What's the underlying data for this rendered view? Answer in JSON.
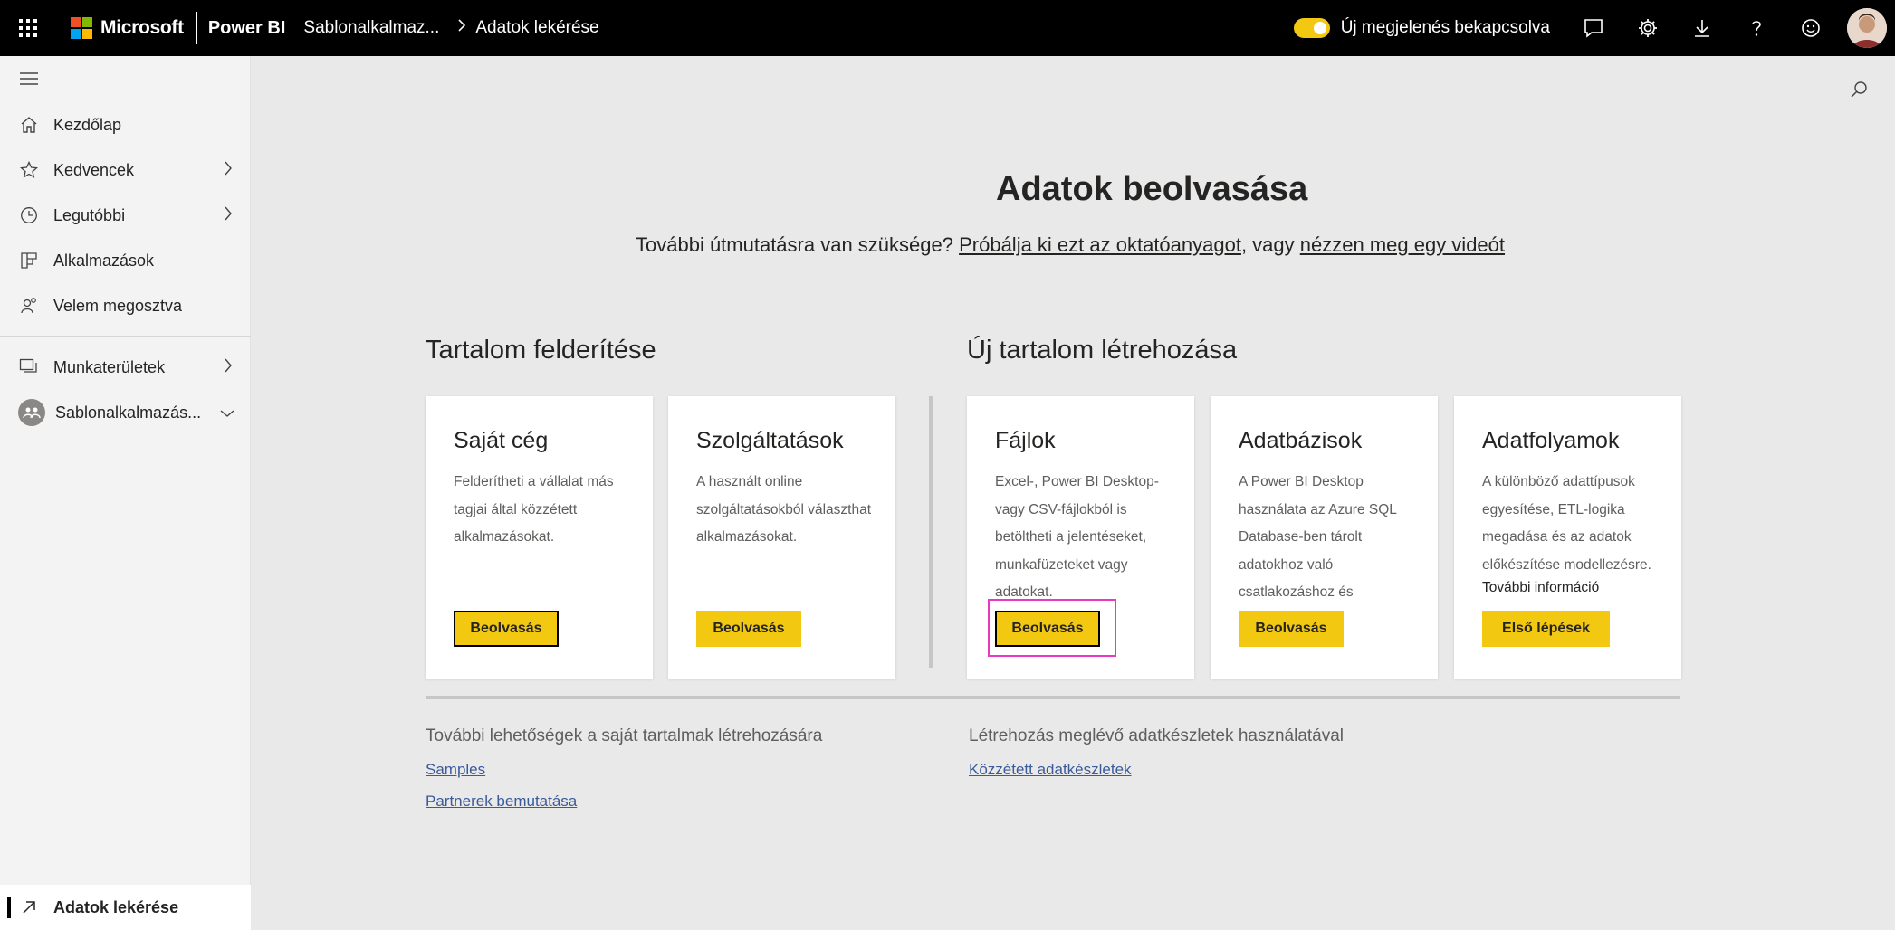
{
  "topbar": {
    "brand": "Microsoft",
    "product": "Power BI",
    "breadcrumb": [
      "Sablonalkalmaz...",
      "Adatok lekérése"
    ],
    "toggle_label": "Új megjelenés bekapcsolva",
    "icons": [
      "chat-icon",
      "gear-icon",
      "download-icon",
      "help-icon",
      "smiley-icon"
    ],
    "accent": "#f2c811"
  },
  "sidebar": {
    "items": [
      {
        "label": "Kezdőlap",
        "icon": "home-icon"
      },
      {
        "label": "Kedvencek",
        "icon": "star-icon",
        "chevron": true
      },
      {
        "label": "Legutóbbi",
        "icon": "clock-icon",
        "chevron": true
      },
      {
        "label": "Alkalmazások",
        "icon": "apps-icon"
      },
      {
        "label": "Velem megosztva",
        "icon": "shared-icon"
      },
      {
        "label": "Munkaterületek",
        "icon": "workspaces-icon",
        "chevron": true
      },
      {
        "label": "Sablonalkalmazás...",
        "icon": "workspace-avatar",
        "chevron_down": true
      }
    ],
    "bottom_item": "Adatok lekérése"
  },
  "main": {
    "title": "Adatok beolvasása",
    "subtitle_pre": "További útmutatásra van szüksége? ",
    "subtitle_link1": "Próbálja ki ezt az oktatóanyagot",
    "subtitle_mid": ", vagy ",
    "subtitle_link2": "nézzen meg egy videót",
    "discover_heading": "Tartalom felderítése",
    "create_heading": "Új tartalom létrehozása",
    "cards": [
      {
        "title": "Saját cég",
        "desc": "Felderítheti a vállalat más tagjai által közzétett alkalmazásokat.",
        "button": "Beolvasás"
      },
      {
        "title": "Szolgáltatások",
        "desc": "A használt online szolgáltatásokból választhat alkalmazásokat.",
        "button": "Beolvasás"
      },
      {
        "title": "Fájlok",
        "desc": "Excel-, Power BI Desktop- vagy CSV-fájlokból is betöltheti a jelentéseket, munkafüzeteket vagy adatokat.",
        "button": "Beolvasás"
      },
      {
        "title": "Adatbázisok",
        "desc": "A Power BI Desktop használata az Azure SQL Database-ben tárolt adatokhoz való csatlakozáshoz és egyebekhez.",
        "button": "Beolvasás"
      },
      {
        "title": "Adatfolyamok",
        "desc": "A különböző adattípusok egyesítése, ETL-logika megadása és az adatok előkészítése modellezésre.",
        "link": "További információ",
        "button": "Első lépések"
      }
    ],
    "more_left_heading": "További lehetőségek a saját tartalmak létrehozására",
    "more_left_links": [
      "Samples",
      "Partnerek bemutatása"
    ],
    "more_right_heading": "Létrehozás meglévő adatkészletek használatával",
    "more_right_links": [
      "Közzétett adatkészletek"
    ]
  }
}
